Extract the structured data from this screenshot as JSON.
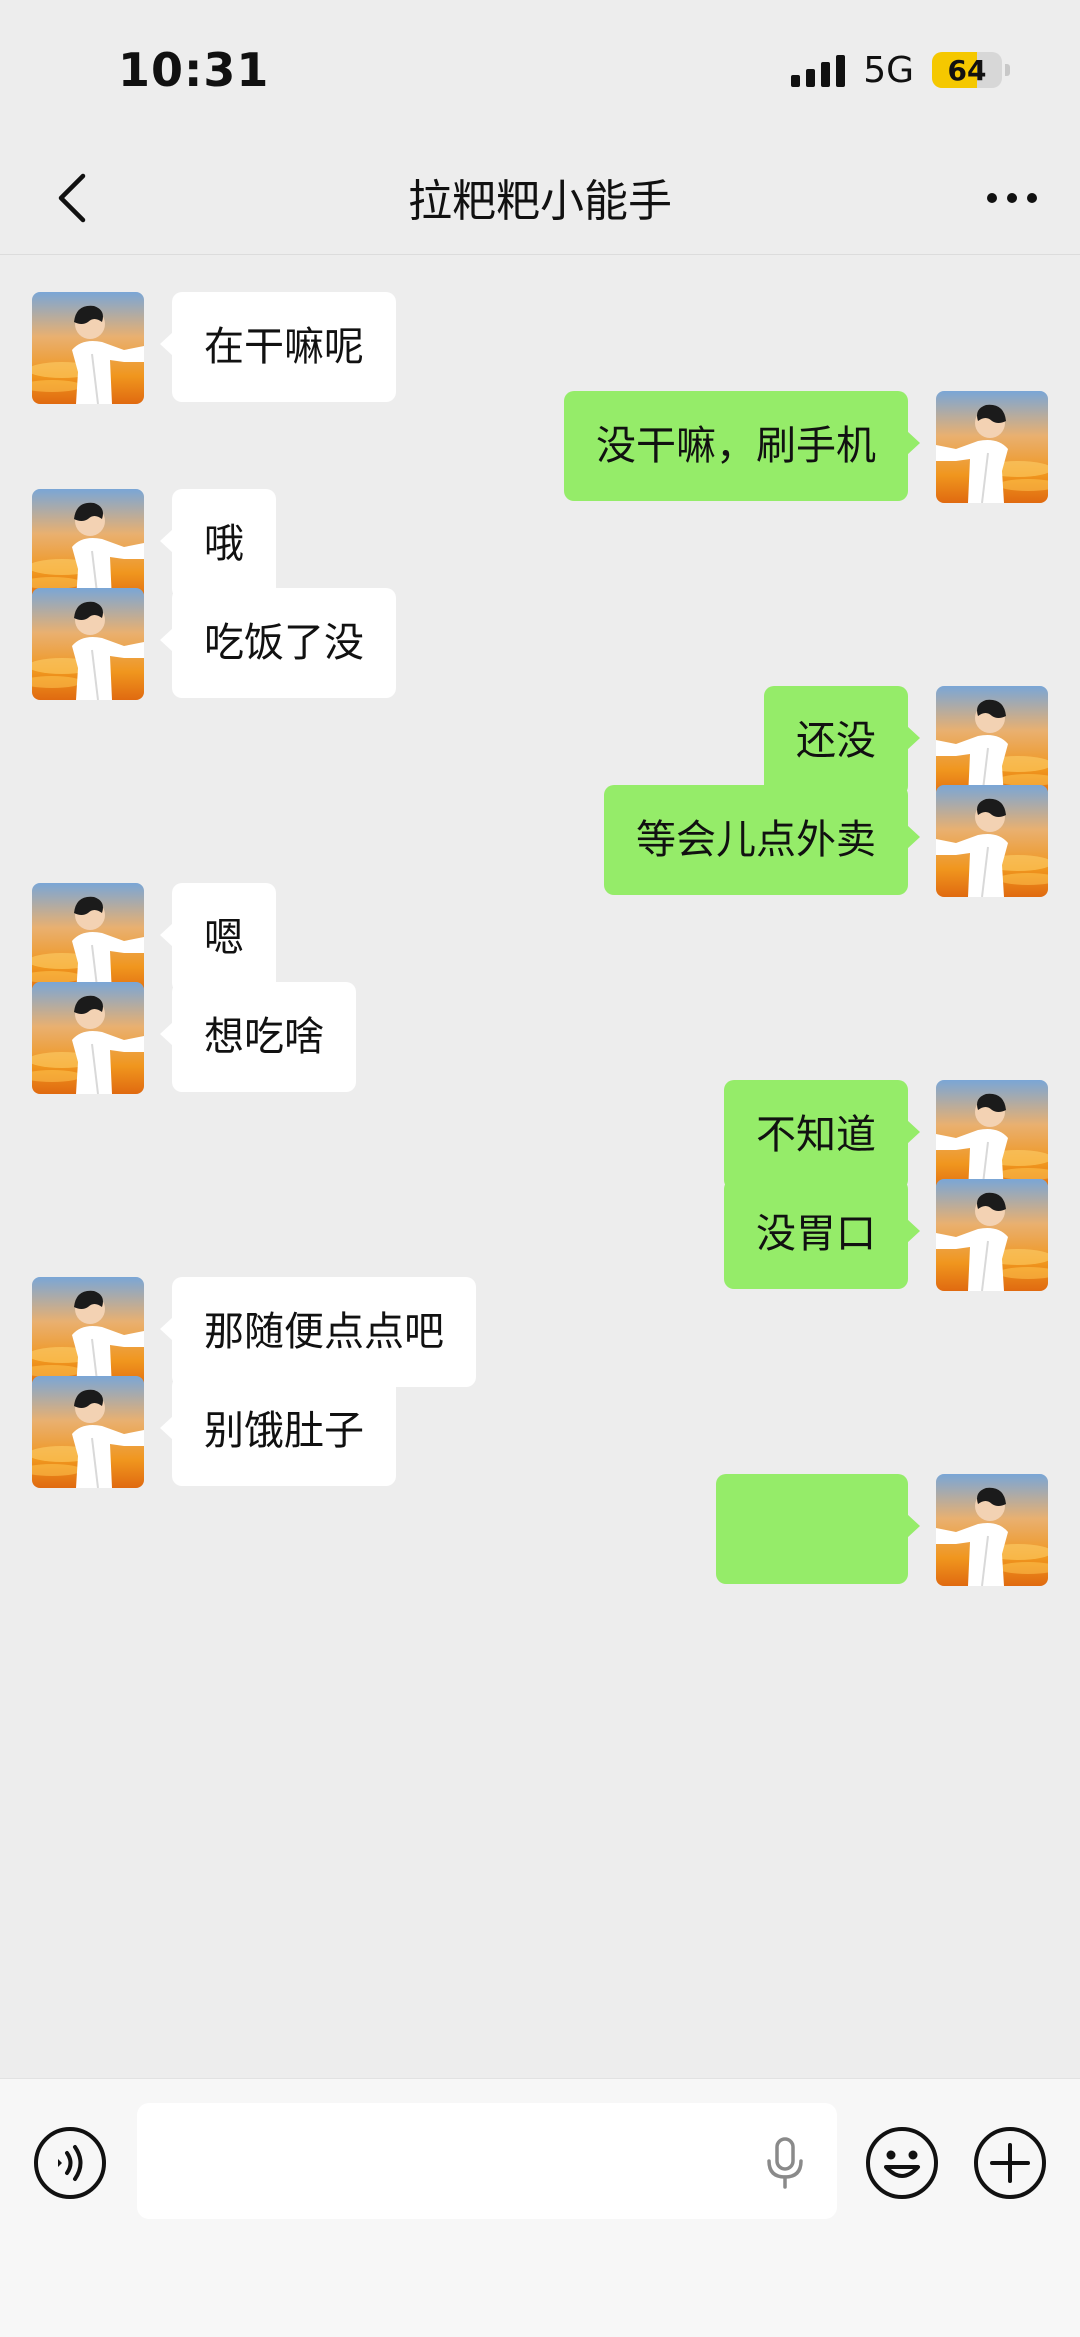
{
  "status_bar": {
    "time": "10:31",
    "network": "5G",
    "battery_level": "64",
    "battery_fraction": 0.64
  },
  "nav": {
    "title": "拉粑粑小能手",
    "back_icon": "chevron-left-icon",
    "more_icon": "more-dots-icon"
  },
  "messages": [
    {
      "side": "left",
      "text": "在干嘛呢"
    },
    {
      "side": "right",
      "text": "没干嘛，刷手机"
    },
    {
      "side": "left",
      "text": "哦"
    },
    {
      "side": "left",
      "text": "吃饭了没"
    },
    {
      "side": "right",
      "text": "还没"
    },
    {
      "side": "right",
      "text": "等会儿点外卖"
    },
    {
      "side": "left",
      "text": "嗯"
    },
    {
      "side": "left",
      "text": "想吃啥"
    },
    {
      "side": "right",
      "text": "不知道"
    },
    {
      "side": "right",
      "text": "没胃口"
    },
    {
      "side": "left",
      "text": "那随便点点吧"
    },
    {
      "side": "left",
      "text": "别饿肚子"
    },
    {
      "side": "right",
      "text": ""
    }
  ],
  "input_bar": {
    "voice_icon": "voice-icon",
    "mic_icon": "mic-icon",
    "emoji_icon": "emoji-icon",
    "plus_icon": "plus-icon",
    "text_value": ""
  },
  "colors": {
    "background": "#ededed",
    "bubble_sent": "#95ec69",
    "bubble_received": "#ffffff",
    "battery": "#f5c800"
  }
}
